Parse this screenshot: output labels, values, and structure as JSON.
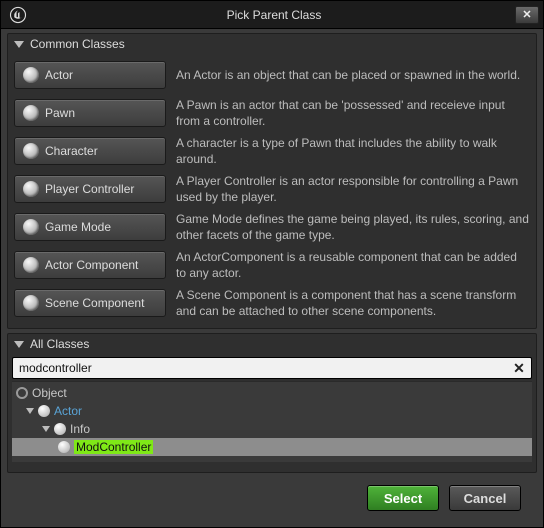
{
  "window": {
    "title": "Pick Parent Class"
  },
  "sections": {
    "common": {
      "title": "Common Classes"
    },
    "all": {
      "title": "All Classes"
    }
  },
  "common_classes": [
    {
      "name": "Actor",
      "desc": "An Actor is an object that can be placed or spawned in the world."
    },
    {
      "name": "Pawn",
      "desc": "A Pawn is an actor that can be 'possessed' and receieve input from a controller."
    },
    {
      "name": "Character",
      "desc": "A character is a type of Pawn that includes the ability to walk around."
    },
    {
      "name": "Player Controller",
      "desc": "A Player Controller is an actor responsible for controlling a Pawn used by the player."
    },
    {
      "name": "Game Mode",
      "desc": "Game Mode defines the game being played, its rules, scoring, and other facets of the game type."
    },
    {
      "name": "Actor Component",
      "desc": "An ActorComponent is a reusable component that can be added to any actor."
    },
    {
      "name": "Scene Component",
      "desc": "A Scene Component is a component that has a scene transform and can be attached to other scene components."
    }
  ],
  "search": {
    "value": "modcontroller"
  },
  "tree": {
    "root": "Object",
    "n1": "Actor",
    "n2": "Info",
    "n3": "ModController"
  },
  "buttons": {
    "select": "Select",
    "cancel": "Cancel"
  }
}
